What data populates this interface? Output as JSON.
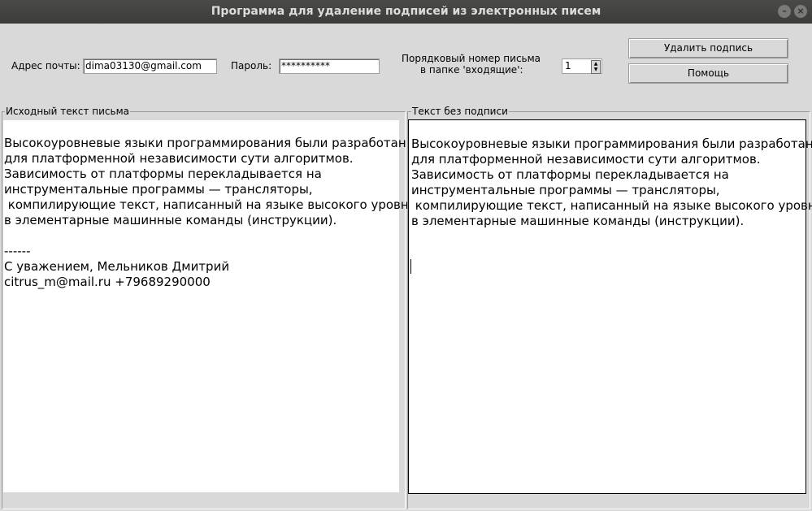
{
  "window": {
    "title": "Программа для удаление подписей из электронных писем",
    "minimize_glyph": "–",
    "close_glyph": "×"
  },
  "form": {
    "email_label": "Адрес почты:",
    "email_value": "dima03130@gmail.com",
    "password_label": "Пароль:",
    "password_value": "**********",
    "letter_number_label_line1": "Порядковый номер письма",
    "letter_number_label_line2": "в папке 'входящие':",
    "letter_number_value": "1",
    "spin_up_glyph": "▲",
    "spin_down_glyph": "▼"
  },
  "buttons": {
    "remove_signature": "Удалить подпись",
    "help": "Помощь"
  },
  "source_panel": {
    "title": "Исходный текст письма",
    "lines": [
      "",
      "Высокоуровневые языки программирования были разработаны",
      "для платформенной независимости сути алгоритмов.",
      "Зависимость от платформы перекладывается на",
      "инструментальные программы — трансляторы,",
      " компилирующие текст, написанный на языке высокого уровня,",
      "в элементарные машинные команды (инструкции).",
      "",
      "------",
      "С уважением, Мельников Дмитрий",
      "citrus_m@mail.ru +79689290000"
    ]
  },
  "result_panel": {
    "title": "Текст без подписи",
    "lines": [
      "",
      "Высокоуровневые языки программирования были разработаны",
      "для платформенной независимости сути алгоритмов.",
      "Зависимость от платформы перекладывается на",
      "инструментальные программы — трансляторы,",
      " компилирующие текст, написанный на языке высокого уровня,",
      "в элементарные машинные команды (инструкции)."
    ]
  }
}
